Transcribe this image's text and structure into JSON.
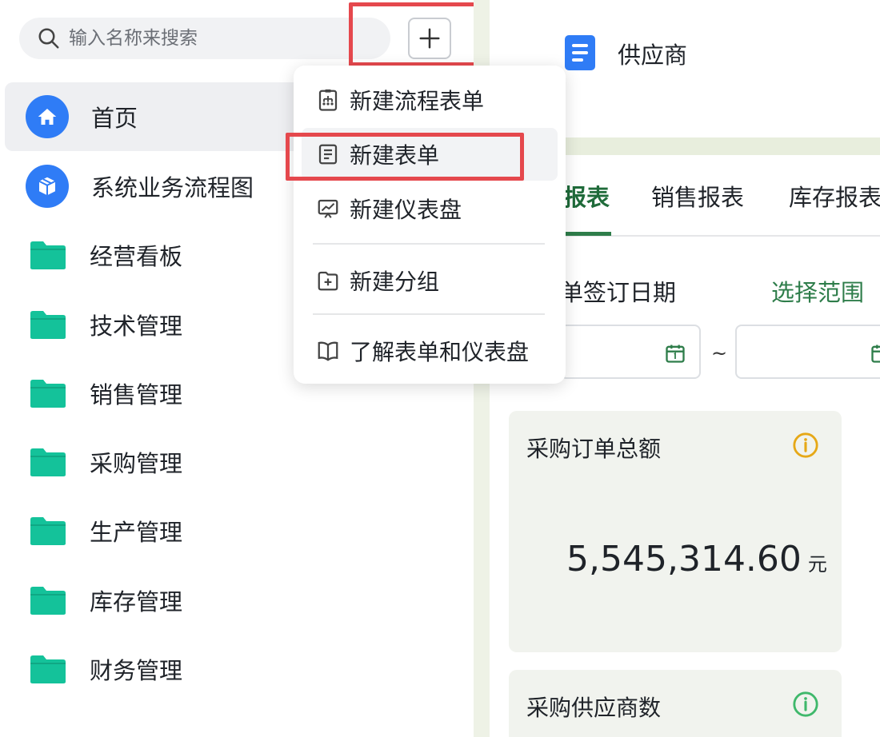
{
  "sidebar": {
    "search_placeholder": "输入名称来搜索",
    "items": [
      {
        "label": "首页",
        "icon": "home-icon"
      },
      {
        "label": "系统业务流程图",
        "icon": "box-icon"
      },
      {
        "label": "经营看板",
        "icon": "folder-icon"
      },
      {
        "label": "技术管理",
        "icon": "folder-icon"
      },
      {
        "label": "销售管理",
        "icon": "folder-icon"
      },
      {
        "label": "采购管理",
        "icon": "folder-icon"
      },
      {
        "label": "生产管理",
        "icon": "folder-icon"
      },
      {
        "label": "库存管理",
        "icon": "folder-icon"
      },
      {
        "label": "财务管理",
        "icon": "folder-icon"
      }
    ]
  },
  "menu": {
    "items": [
      {
        "label": "新建流程表单",
        "icon": "flow-form-icon"
      },
      {
        "label": "新建表单",
        "icon": "form-icon"
      },
      {
        "label": "新建仪表盘",
        "icon": "dashboard-icon"
      },
      {
        "label": "新建分组",
        "icon": "add-group-icon"
      },
      {
        "label": "了解表单和仪表盘",
        "icon": "book-icon"
      }
    ]
  },
  "main": {
    "title": "供应商",
    "tabs": [
      "报表",
      "销售报表",
      "库存报表"
    ],
    "filter_label": "单签订日期",
    "range_link": "选择范围",
    "range_separator": "~",
    "cards": [
      {
        "title": "采购订单总额",
        "value": "5,545,314.60",
        "unit": "元",
        "info_color": "#e6a817"
      },
      {
        "title": "采购供应商数",
        "info_color": "#3fb86b"
      }
    ]
  },
  "colors": {
    "accent_green": "#2e7d4a",
    "brand_blue": "#2f7cf6",
    "folder_teal": "#14c29a",
    "highlight_red": "#e5484d"
  }
}
